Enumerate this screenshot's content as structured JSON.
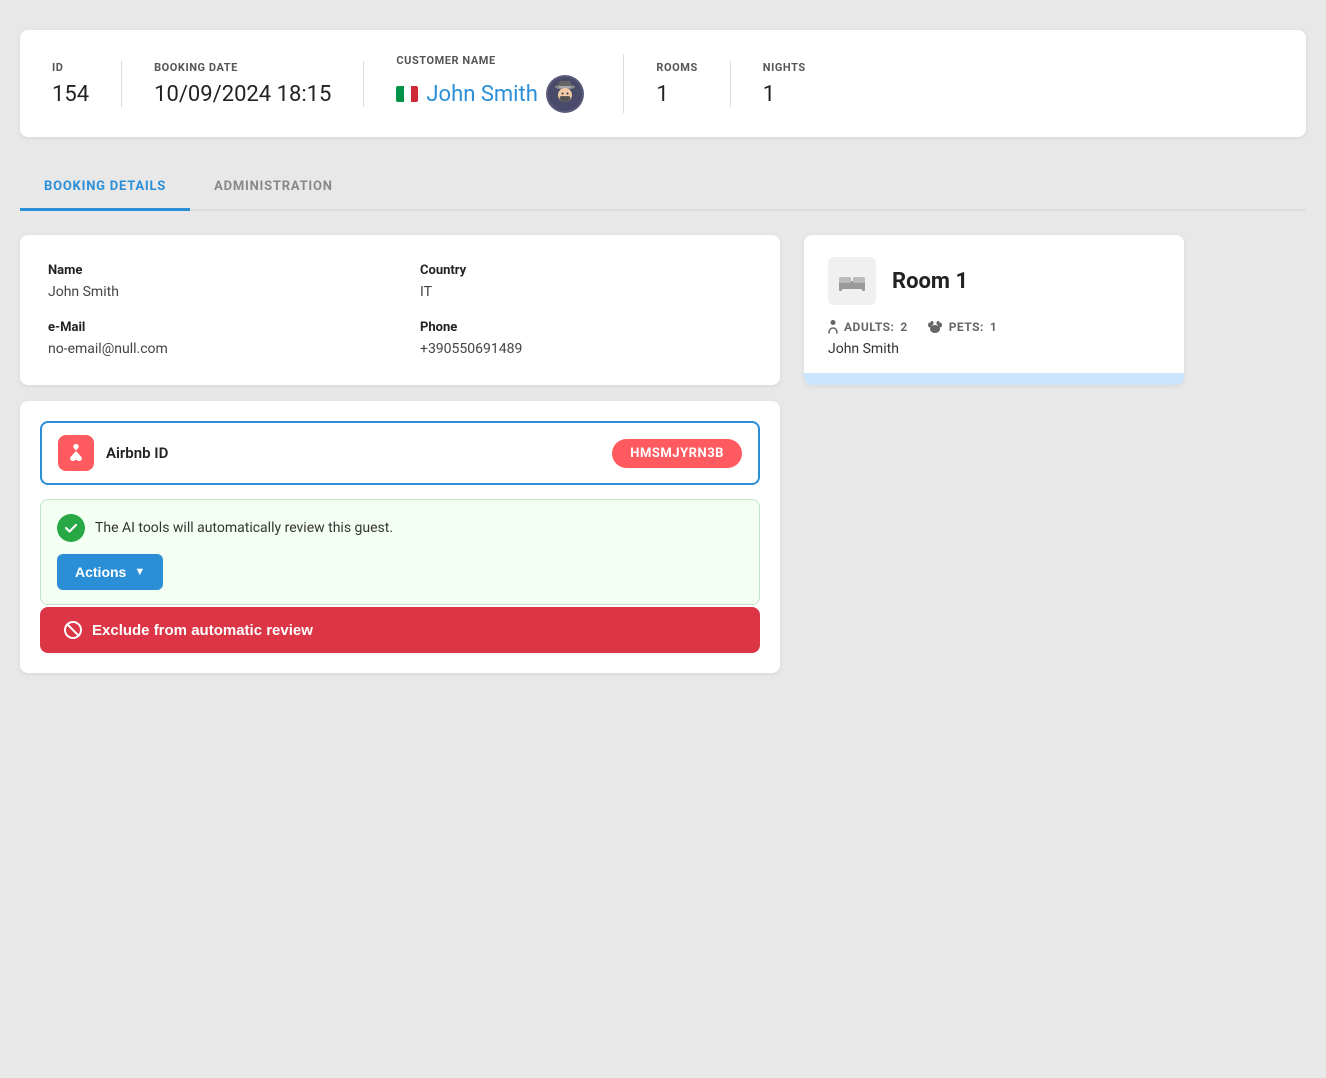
{
  "header": {
    "id_label": "ID",
    "id_value": "154",
    "booking_date_label": "BOOKING DATE",
    "booking_date_value": "10/09/2024 18:15",
    "customer_name_label": "CUSTOMER NAME",
    "customer_name_value": "John Smith",
    "rooms_label": "ROOMS",
    "rooms_value": "1",
    "nights_label": "NIGHTS",
    "nights_value": "1"
  },
  "tabs": {
    "booking_details": "BOOKING DETAILS",
    "administration": "ADMINISTRATION"
  },
  "customer": {
    "name_label": "Name",
    "name_value": "John Smith",
    "country_label": "Country",
    "country_value": "IT",
    "email_label": "e-Mail",
    "email_value": "no-email@null.com",
    "phone_label": "Phone",
    "phone_value": "+390550691489"
  },
  "source": {
    "airbnb_label": "Airbnb ID",
    "airbnb_id": "HMSMJYRN3B",
    "ai_notice": "The AI tools will automatically review this guest.",
    "actions_label": "Actions",
    "exclude_label": "Exclude from automatic review"
  },
  "room": {
    "title": "Room 1",
    "adults_label": "ADULTS:",
    "adults_value": "2",
    "pets_label": "PETS:",
    "pets_value": "1",
    "guest_name": "John Smith"
  },
  "colors": {
    "blue": "#2b8fd8",
    "red": "#dc3545",
    "green": "#28a745",
    "airbnb": "#ff5a5f"
  }
}
